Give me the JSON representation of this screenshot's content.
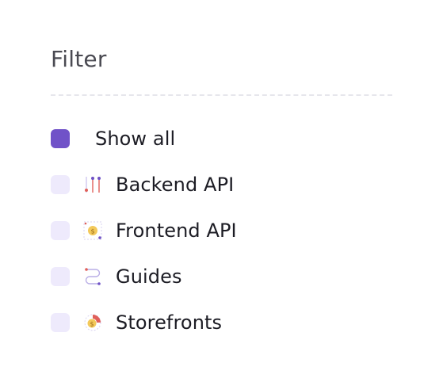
{
  "filter": {
    "title": "Filter",
    "show_all": {
      "label": "Show all",
      "checked": true
    },
    "items": [
      {
        "label": "Backend API",
        "icon": "sliders-icon",
        "checked": false
      },
      {
        "label": "Frontend API",
        "icon": "coin-icon",
        "checked": false
      },
      {
        "label": "Guides",
        "icon": "path-icon",
        "checked": false
      },
      {
        "label": "Storefronts",
        "icon": "coin-chart-icon",
        "checked": false
      }
    ]
  },
  "colors": {
    "accent": "#7052c8",
    "checkbox_unchecked": "#eeeafc",
    "divider": "#e6e6ec",
    "icon_red": "#e0605a",
    "icon_yellow": "#f3c95b",
    "icon_purple": "#6f52c6"
  }
}
